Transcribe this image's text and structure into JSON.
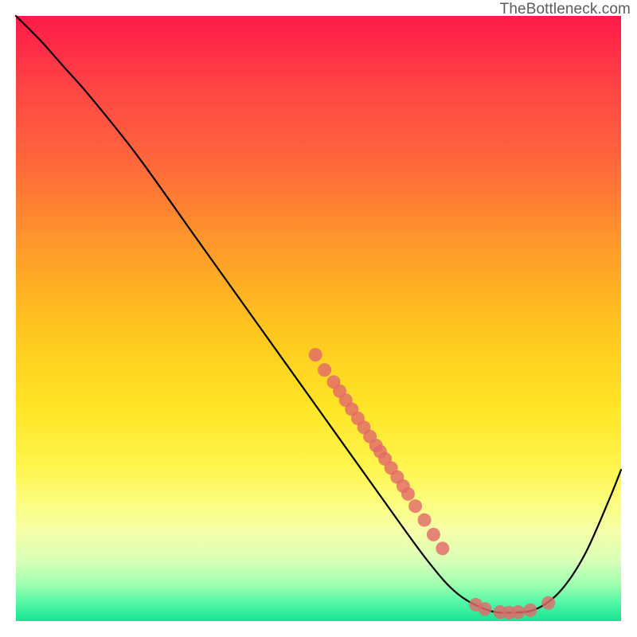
{
  "watermark": "TheBottleneck.com",
  "chart_data": {
    "type": "line",
    "title": "",
    "xlabel": "",
    "ylabel": "",
    "xlim": [
      0,
      100
    ],
    "ylim": [
      0,
      100
    ],
    "curve": [
      {
        "x": 0,
        "y": 100
      },
      {
        "x": 4,
        "y": 96
      },
      {
        "x": 8,
        "y": 91.5
      },
      {
        "x": 12,
        "y": 87
      },
      {
        "x": 20,
        "y": 77
      },
      {
        "x": 30,
        "y": 63
      },
      {
        "x": 40,
        "y": 49
      },
      {
        "x": 50,
        "y": 35
      },
      {
        "x": 60,
        "y": 21
      },
      {
        "x": 68,
        "y": 10
      },
      {
        "x": 73,
        "y": 4.5
      },
      {
        "x": 78,
        "y": 1.8
      },
      {
        "x": 82,
        "y": 1.4
      },
      {
        "x": 86,
        "y": 2
      },
      {
        "x": 90,
        "y": 5
      },
      {
        "x": 94,
        "y": 11
      },
      {
        "x": 98,
        "y": 20
      },
      {
        "x": 100,
        "y": 25
      }
    ],
    "series": [
      {
        "name": "highlighted-points",
        "points": [
          {
            "x": 49.5,
            "y": 44
          },
          {
            "x": 51,
            "y": 41.5
          },
          {
            "x": 52.5,
            "y": 39.5
          },
          {
            "x": 53.5,
            "y": 38
          },
          {
            "x": 54.5,
            "y": 36.5
          },
          {
            "x": 55.5,
            "y": 35
          },
          {
            "x": 56.5,
            "y": 33.5
          },
          {
            "x": 57.5,
            "y": 32
          },
          {
            "x": 58.5,
            "y": 30.5
          },
          {
            "x": 59.5,
            "y": 29
          },
          {
            "x": 60.2,
            "y": 28
          },
          {
            "x": 61,
            "y": 26.8
          },
          {
            "x": 62,
            "y": 25.3
          },
          {
            "x": 63,
            "y": 23.8
          },
          {
            "x": 64,
            "y": 22.3
          },
          {
            "x": 64.8,
            "y": 21
          },
          {
            "x": 66,
            "y": 19
          },
          {
            "x": 67.5,
            "y": 16.7
          },
          {
            "x": 69,
            "y": 14.3
          },
          {
            "x": 70.5,
            "y": 12
          },
          {
            "x": 76,
            "y": 2.7
          },
          {
            "x": 77.5,
            "y": 2
          },
          {
            "x": 80,
            "y": 1.5
          },
          {
            "x": 81.5,
            "y": 1.4
          },
          {
            "x": 83,
            "y": 1.5
          },
          {
            "x": 85,
            "y": 1.8
          },
          {
            "x": 88,
            "y": 3
          }
        ]
      }
    ]
  }
}
